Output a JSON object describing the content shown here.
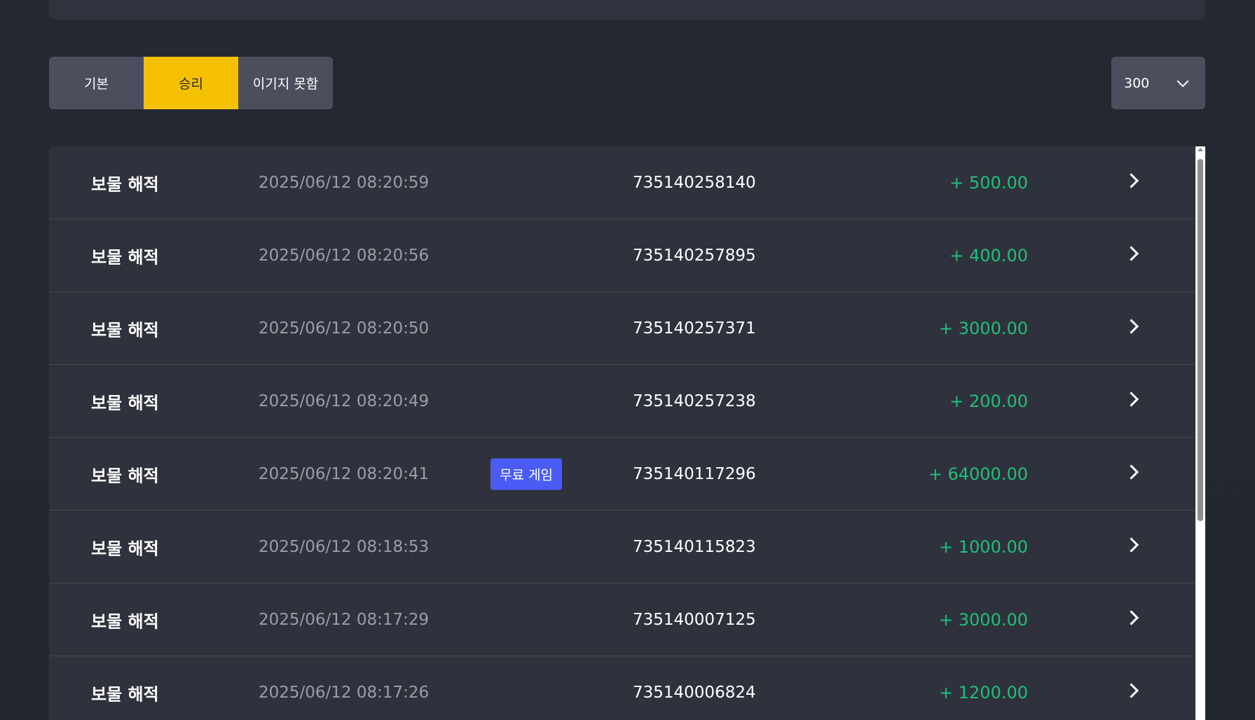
{
  "filters": {
    "tabs": [
      {
        "label": "기본",
        "active": false
      },
      {
        "label": "승리",
        "active": true
      },
      {
        "label": "이기지 못함",
        "active": false
      }
    ],
    "count": "300"
  },
  "colors": {
    "active_tab": "#f5c000",
    "amount": "#1fbf7a",
    "badge": "#4a5cf5"
  },
  "records": [
    {
      "game": "보물 해적",
      "time": "2025/06/12 08:20:59",
      "badge": "",
      "id": "735140258140",
      "amount": "+ 500.00"
    },
    {
      "game": "보물 해적",
      "time": "2025/06/12 08:20:56",
      "badge": "",
      "id": "735140257895",
      "amount": "+ 400.00"
    },
    {
      "game": "보물 해적",
      "time": "2025/06/12 08:20:50",
      "badge": "",
      "id": "735140257371",
      "amount": "+ 3000.00"
    },
    {
      "game": "보물 해적",
      "time": "2025/06/12 08:20:49",
      "badge": "",
      "id": "735140257238",
      "amount": "+ 200.00"
    },
    {
      "game": "보물 해적",
      "time": "2025/06/12 08:20:41",
      "badge": "무료 게임",
      "id": "735140117296",
      "amount": "+ 64000.00"
    },
    {
      "game": "보물 해적",
      "time": "2025/06/12 08:18:53",
      "badge": "",
      "id": "735140115823",
      "amount": "+ 1000.00"
    },
    {
      "game": "보물 해적",
      "time": "2025/06/12 08:17:29",
      "badge": "",
      "id": "735140007125",
      "amount": "+ 3000.00"
    },
    {
      "game": "보물 해적",
      "time": "2025/06/12 08:17:26",
      "badge": "",
      "id": "735140006824",
      "amount": "+ 1200.00"
    }
  ]
}
